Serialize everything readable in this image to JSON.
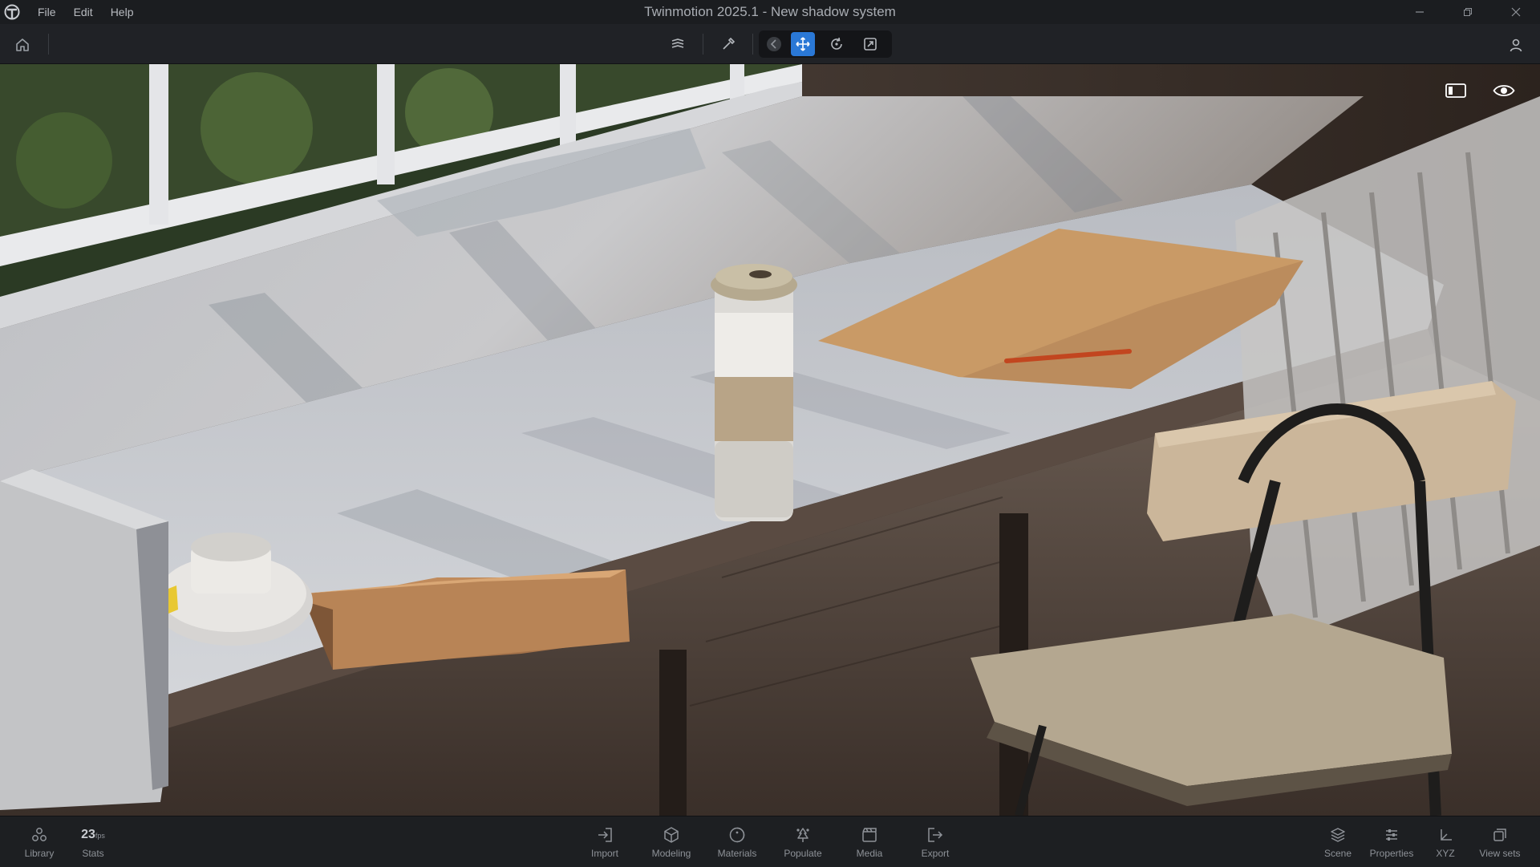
{
  "titlebar": {
    "title": "Twinmotion 2025.1 - New shadow system",
    "menu": [
      "File",
      "Edit",
      "Help"
    ]
  },
  "toolbar": {
    "tools": [
      {
        "name": "layers-icon",
        "active": false
      },
      {
        "name": "pipette-icon",
        "active": false
      },
      {
        "name": "back-icon",
        "active": false
      },
      {
        "name": "move-icon",
        "active": true
      },
      {
        "name": "rotate-icon",
        "active": false
      },
      {
        "name": "scale-icon",
        "active": false
      }
    ]
  },
  "bottombar": {
    "left": [
      {
        "label": "Library",
        "icon": "library-icon"
      },
      {
        "label": "Stats",
        "value": "23",
        "unit": "fps"
      }
    ],
    "center": [
      {
        "label": "Import",
        "icon": "import-icon"
      },
      {
        "label": "Modeling",
        "icon": "cube-icon"
      },
      {
        "label": "Materials",
        "icon": "materials-icon"
      },
      {
        "label": "Populate",
        "icon": "populate-icon"
      },
      {
        "label": "Media",
        "icon": "media-icon"
      },
      {
        "label": "Export",
        "icon": "export-icon"
      }
    ],
    "right": [
      {
        "label": "Scene",
        "icon": "scene-icon"
      },
      {
        "label": "Properties",
        "icon": "properties-icon"
      },
      {
        "label": "XYZ",
        "icon": "xyz-icon"
      },
      {
        "label": "View sets",
        "icon": "view-sets-icon"
      }
    ]
  },
  "colors": {
    "accent": "#2a78d6",
    "chrome_dark": "#1b1d20",
    "toolbar": "#202226"
  }
}
